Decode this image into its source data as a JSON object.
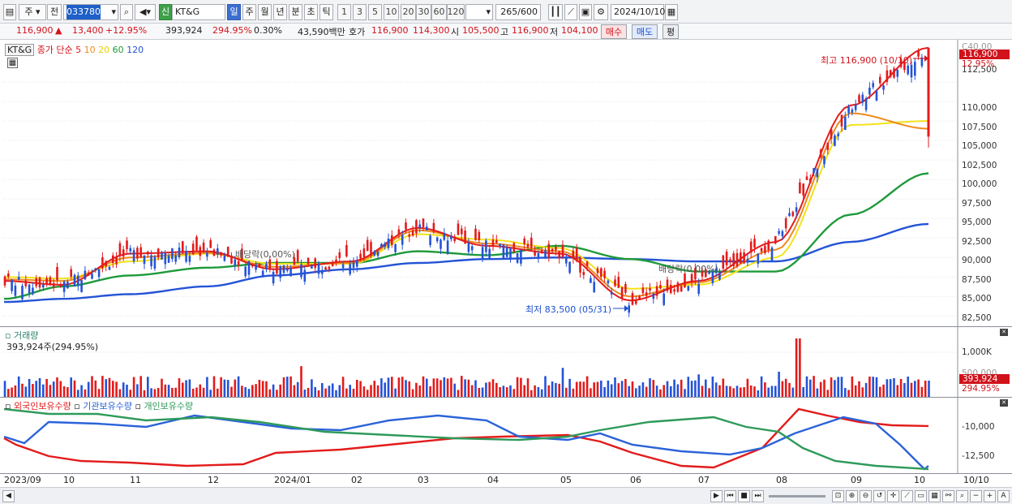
{
  "toolbar": {
    "period_selector": "주",
    "prev_label": "전",
    "stock_code": "033780",
    "market_badge": "신",
    "stock_name": "KT&G",
    "intervals": [
      "일",
      "주",
      "월",
      "년",
      "분",
      "초",
      "틱"
    ],
    "active_interval": "일",
    "numbers": [
      "1",
      "3",
      "5",
      "10",
      "20",
      "30",
      "60",
      "120"
    ],
    "count": "265",
    "count_total": "/600",
    "date": "2024/10/10"
  },
  "quote": {
    "price": "116,900",
    "change_arrow": "▲",
    "change": "13,400",
    "change_pct": "+12.95%",
    "volume": "393,924",
    "volume_pct": "294.95%",
    "turnover_pct": "0.30%",
    "amount": "43,590백만",
    "ask_label": "호가",
    "ask": "116,900",
    "bid": "114,300",
    "open_label": "시",
    "open": "105,500",
    "high_label": "고",
    "high": "116,900",
    "low_label": "저",
    "low": "104,100",
    "buy_label": "매수",
    "sell_label": "매도",
    "eval_label": "평"
  },
  "price_panel": {
    "legend_name": "KT&G",
    "legend_ma_label": "종가 단순",
    "legend_ma": [
      "5",
      "10",
      "20",
      "60",
      "120"
    ],
    "ma_colors": [
      "#e31b1b",
      "#f08a1c",
      "#f2e21a",
      "#1e9a3a",
      "#2453d6"
    ],
    "y_ticks": [
      "112,500",
      "110,000",
      "107,500",
      "105,000",
      "102,500",
      "100,000",
      "97,500",
      "95,000",
      "92,500",
      "90,000",
      "87,500",
      "85,000",
      "82,500"
    ],
    "y_top_partial": "C40,00",
    "last_price_tag": "116,900",
    "last_pct_tag": "12.95%",
    "max_label": "최고 116,900 (10/10)",
    "min_label": "최저 83,500 (05/31)",
    "ex_div_1": "배당락(0.00%)",
    "ex_div_2": "배당락(0.00%)"
  },
  "volume_panel": {
    "title": "거래량",
    "value_label": "393,924주(294.95%)",
    "y_tick": "1,000K",
    "y_tick_partial": "500,000",
    "last_tag": "393,924",
    "last_pct": "294.95%"
  },
  "holdings_panel": {
    "legend": [
      "외국인보유수량",
      "기관보유수량",
      "개인보유수량"
    ],
    "colors": [
      "#e31b1b",
      "#2b63d9",
      "#2e9a5a"
    ],
    "y_ticks": [
      "-10,000",
      "-12,500"
    ]
  },
  "x_axis": {
    "labels": [
      "2023/09",
      "10",
      "11",
      "12",
      "2024/01",
      "02",
      "03",
      "04",
      "05",
      "06",
      "07",
      "08",
      "09",
      "10"
    ],
    "right_label": "10/10"
  },
  "chart_data": {
    "type": "line",
    "title": "",
    "x": [
      "2023/09",
      "10",
      "11",
      "12",
      "2024/01",
      "02",
      "03",
      "04",
      "05",
      "06",
      "07",
      "08",
      "09",
      "10"
    ],
    "ylim": [
      81500,
      117500
    ],
    "series": [
      {
        "name": "5",
        "values": [
          87000,
          86500,
          90500,
          90800,
          88500,
          89500,
          93800,
          91500,
          90500,
          84500,
          87000,
          92000,
          109500,
          116900
        ]
      },
      {
        "name": "10",
        "values": [
          87200,
          87000,
          90000,
          90600,
          88800,
          89300,
          93500,
          91800,
          90800,
          85000,
          86800,
          91000,
          108500,
          106500
        ]
      },
      {
        "name": "20",
        "values": [
          87500,
          87300,
          89500,
          90500,
          89200,
          89200,
          93000,
          92300,
          91200,
          86000,
          86500,
          90000,
          107000,
          107500
        ]
      },
      {
        "name": "60",
        "values": [
          84700,
          86300,
          87700,
          88700,
          89300,
          89300,
          90800,
          90300,
          91500,
          89800,
          88200,
          88200,
          95500,
          100800
        ]
      },
      {
        "name": "120",
        "values": [
          84300,
          84700,
          85300,
          86300,
          87700,
          88500,
          89300,
          89800,
          90000,
          89800,
          89500,
          89500,
          92000,
          94300
        ]
      }
    ]
  }
}
